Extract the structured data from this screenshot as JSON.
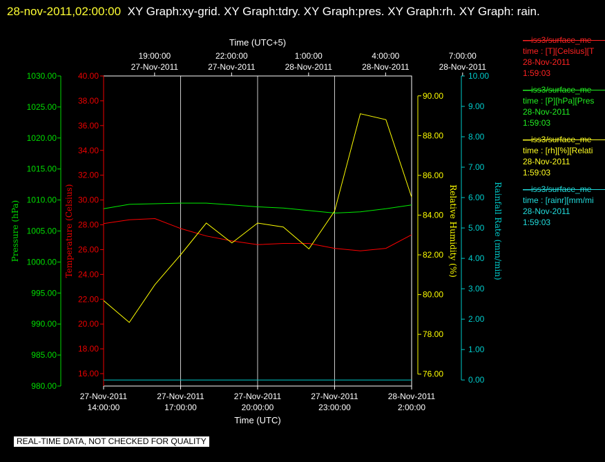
{
  "header": {
    "timestamp": "28-nov-2011,02:00:00",
    "title_text": "XY Graph:xy-grid.  XY Graph:tdry.  XY Graph:pres.  XY Graph:rh.  XY Graph: rain."
  },
  "chart_data": {
    "type": "line",
    "top_axis": {
      "title": "Time (UTC+5)",
      "ticks": [
        {
          "time": "19:00:00",
          "date": "27-Nov-2011"
        },
        {
          "time": "22:00:00",
          "date": "27-Nov-2011"
        },
        {
          "time": "1:00:00",
          "date": "28-Nov-2011"
        },
        {
          "time": "4:00:00",
          "date": "28-Nov-2011"
        },
        {
          "time": "7:00:00",
          "date": "28-Nov-2011"
        }
      ]
    },
    "bottom_axis": {
      "title": "Time (UTC)",
      "range": [
        "2011-11-27 14:00",
        "2011-11-28 02:00"
      ],
      "ticks": [
        {
          "date": "27-Nov-2011",
          "time": "14:00:00"
        },
        {
          "date": "27-Nov-2011",
          "time": "17:00:00"
        },
        {
          "date": "27-Nov-2011",
          "time": "20:00:00"
        },
        {
          "date": "27-Nov-2011",
          "time": "23:00:00"
        },
        {
          "date": "28-Nov-2011",
          "time": "2:00:00"
        }
      ]
    },
    "axes": {
      "pressure": {
        "label": "Pressure (hPa)",
        "range": [
          980,
          1030
        ],
        "ticks": [
          "980.00",
          "985.00",
          "990.00",
          "995.00",
          "1000.00",
          "1005.00",
          "1010.00",
          "1015.00",
          "1020.00",
          "1025.00",
          "1030.00"
        ],
        "color": "#00dd00"
      },
      "temperature": {
        "label": "Temperature (Celsius)",
        "range": [
          15,
          40
        ],
        "ticks": [
          "16.00",
          "18.00",
          "20.00",
          "22.00",
          "24.00",
          "26.00",
          "28.00",
          "30.00",
          "32.00",
          "34.00",
          "36.00",
          "38.00",
          "40.00"
        ],
        "color": "#ee0000"
      },
      "humidity": {
        "label": "Relative Humidity (%)",
        "range": [
          75.4,
          91.0
        ],
        "ticks": [
          "76.00",
          "78.00",
          "80.00",
          "82.00",
          "84.00",
          "86.00",
          "88.00",
          "90.00"
        ],
        "color": "#ffff00"
      },
      "rain": {
        "label": "Rainfall Rate (mm/min)",
        "range": [
          -0.2,
          10.0
        ],
        "ticks": [
          "0.00",
          "1.00",
          "2.00",
          "3.00",
          "4.00",
          "5.00",
          "6.00",
          "7.00",
          "8.00",
          "9.00",
          "10.00"
        ],
        "color": "#00cccc"
      }
    },
    "x_hours": [
      0,
      1,
      2,
      3,
      4,
      5,
      6,
      7,
      8,
      9,
      10,
      11,
      12
    ],
    "series": [
      {
        "key": "pressure",
        "color": "#00ee00",
        "values": [
          1008.6,
          1009.3,
          1009.4,
          1009.5,
          1009.5,
          1009.2,
          1008.9,
          1008.7,
          1008.3,
          1007.9,
          1008.1,
          1008.6,
          1009.2
        ]
      },
      {
        "key": "temperature",
        "color": "#ff0000",
        "values": [
          28.1,
          28.4,
          28.5,
          27.7,
          27.1,
          26.7,
          26.4,
          26.5,
          26.5,
          26.1,
          25.9,
          26.1,
          27.2
        ]
      },
      {
        "key": "humidity",
        "color": "#ffff00",
        "values": [
          79.7,
          78.6,
          80.5,
          82.0,
          83.6,
          82.6,
          83.6,
          83.4,
          82.3,
          84.2,
          89.1,
          88.8,
          84.9
        ]
      },
      {
        "key": "rain",
        "color": "#00cccc",
        "values": [
          0,
          0,
          0,
          0,
          0,
          0,
          0,
          0,
          0,
          0,
          0,
          0,
          0
        ]
      }
    ]
  },
  "legend": [
    {
      "name": "—iss3/surface_me",
      "field": "time : [T][Celsius][T",
      "date": "28-Nov-2011",
      "time": "1:59:03",
      "color": "#ff2222"
    },
    {
      "name": "—iss3/surface_me",
      "field": "time : [P][hPa][Pres",
      "date": "28-Nov-2011",
      "time": "1:59:03",
      "color": "#22ee22"
    },
    {
      "name": "—iss3/surface_me",
      "field": "time : [rh][%][Relati",
      "date": "28-Nov-2011",
      "time": "1:59:03",
      "color": "#ffff22"
    },
    {
      "name": "—iss3/surface_me",
      "field": "time : [rainr][mm/mi",
      "date": "28-Nov-2011",
      "time": "1:59:03",
      "color": "#22dddd"
    }
  ],
  "disclaimer": "REAL-TIME DATA, NOT CHECKED FOR QUALITY"
}
